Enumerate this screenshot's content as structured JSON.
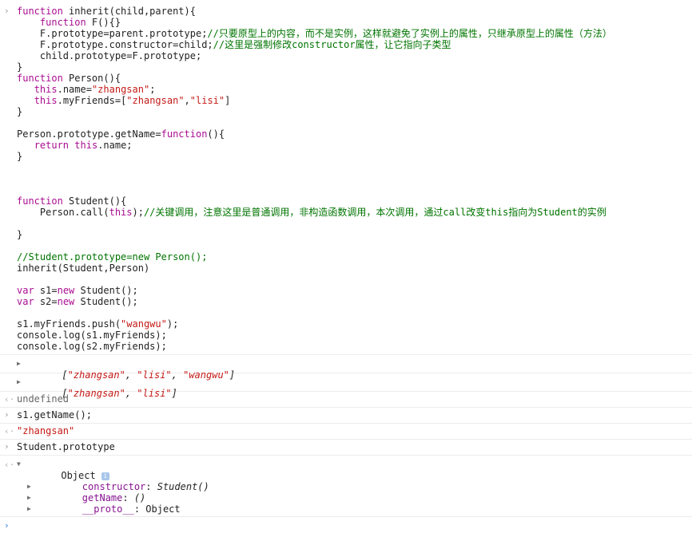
{
  "input_code": [
    [
      "function inherit(child,parent){"
    ],
    [
      "    function F(){}"
    ],
    [
      "    F.prototype=parent.prototype;//只要原型上的内容，而不是实例，这样就避免了实例上的属性，只继承原型上的属性（方法）"
    ],
    [
      "    F.prototype.constructor=child;//这里是强制修改constructor属性，让它指向子类型"
    ],
    [
      "    child.prototype=F.prototype;"
    ],
    [
      "}"
    ],
    [
      "function Person(){"
    ],
    [
      "   this.name=\"zhangsan\";"
    ],
    [
      "   this.myFriends=[\"zhangsan\",\"lisi\"]"
    ],
    [
      "}"
    ],
    [
      ""
    ],
    [
      "Person.prototype.getName=function(){"
    ],
    [
      "   return this.name;"
    ],
    [
      "}"
    ],
    [
      ""
    ],
    [
      ""
    ],
    [
      ""
    ],
    [
      "function Student(){"
    ],
    [
      "    Person.call(this);//关键调用，注意这里是普通调用，非构造函数调用，本次调用，通过call改变this指向为Student的实例"
    ],
    [
      ""
    ],
    [
      "}"
    ],
    [
      ""
    ],
    [
      "//Student.prototype=new Person();"
    ],
    [
      "inherit(Student,Person)"
    ],
    [
      ""
    ],
    [
      "var s1=new Student();"
    ],
    [
      "var s2=new Student();"
    ],
    [
      ""
    ],
    [
      "s1.myFriends.push(\"wangwu\");"
    ],
    [
      "console.log(s1.myFriends);"
    ],
    [
      "console.log(s2.myFriends);"
    ]
  ],
  "code_tokens": {
    "l0": [
      "function",
      " inherit(child,parent){"
    ],
    "l1": [
      "    ",
      "function",
      " F(){}"
    ],
    "l2": [
      "    F.prototype=parent.prototype;",
      "//只要原型上的内容，而不是实例，这样就避免了实例上的属性，只继承原型上的属性（方法）"
    ],
    "l3": [
      "    F.prototype.constructor=child;",
      "//这里是强制修改constructor属性，让它指向子类型"
    ],
    "l4": [
      "    child.prototype=F.prototype;"
    ],
    "l5": [
      "}"
    ],
    "l6": [
      "function",
      " Person(){"
    ],
    "l7": [
      "   ",
      "this",
      ".name=",
      "\"zhangsan\"",
      ";"
    ],
    "l8": [
      "   ",
      "this",
      ".myFriends=[",
      "\"zhangsan\"",
      ",",
      "\"lisi\"",
      "]"
    ],
    "l9": [
      "}"
    ],
    "l11": [
      "Person.prototype.getName=",
      "function",
      "(){"
    ],
    "l12": [
      "   ",
      "return",
      " ",
      "this",
      ".name;"
    ],
    "l13": [
      "}"
    ],
    "l17": [
      "function",
      " Student(){"
    ],
    "l18": [
      "    Person.call(",
      "this",
      ");",
      "//关键调用，注意这里是普通调用，非构造函数调用，本次调用，通过call改变this指向为Student的实例"
    ],
    "l20": [
      "}"
    ],
    "l22": [
      "//Student.prototype=new Person();"
    ],
    "l23": [
      "inherit(Student,Person)"
    ],
    "l25": [
      "var",
      " s1=",
      "new",
      " Student();"
    ],
    "l26": [
      "var",
      " s2=",
      "new",
      " Student();"
    ],
    "l28": [
      "s1.myFriends.push(",
      "\"wangwu\"",
      ");"
    ],
    "l29": [
      "console.log(s1.myFriends);"
    ],
    "l30": [
      "console.log(s2.myFriends);"
    ]
  },
  "log1": {
    "open": "[",
    "items": [
      "\"zhangsan\"",
      "\"lisi\"",
      "\"wangwu\""
    ],
    "close": "]",
    "sep": ", "
  },
  "log2": {
    "open": "[",
    "items": [
      "\"zhangsan\"",
      "\"lisi\""
    ],
    "close": "]",
    "sep": ", "
  },
  "result1": "undefined",
  "input2": "s1.getName();",
  "result2": "\"zhangsan\"",
  "input3": "Student.prototype",
  "result3": {
    "label": "Object",
    "badge": "i",
    "props": [
      {
        "key": "constructor",
        "sep": ": ",
        "value": "Student()"
      },
      {
        "key": "getName",
        "sep": ": ",
        "value": "()"
      },
      {
        "key": "__proto__",
        "sep": ": ",
        "value": "Object"
      }
    ]
  },
  "icons": {
    "input_prompt": "chevron-right-icon",
    "output_marker": "left-arrow-icon",
    "expand": "disclosure-triangle-icon"
  },
  "glyphs": {
    "prompt": "›",
    "result": "‹·",
    "triangle_right": "▶",
    "triangle_down": "▼"
  },
  "colors": {
    "keyword": "#aa0d91",
    "string": "#c41a16",
    "comment": "#007400",
    "property": "#881391",
    "prompt_active": "#2d7ddf"
  }
}
